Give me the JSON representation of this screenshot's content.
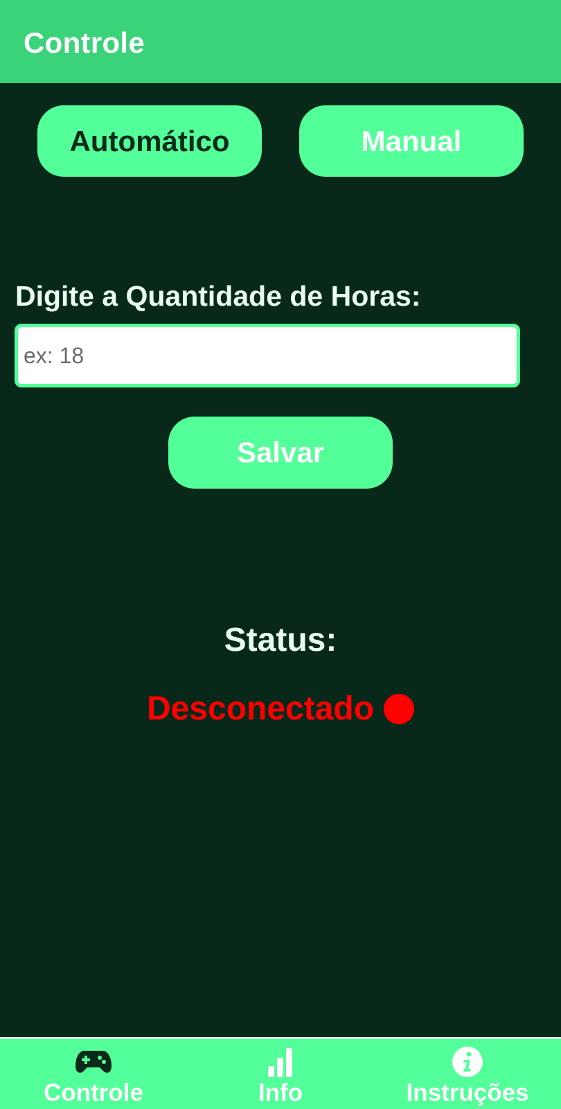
{
  "appbar": {
    "title": "Controle"
  },
  "modes": {
    "automatic_label": "Automático",
    "manual_label": "Manual"
  },
  "hours": {
    "label": "Digite a Quantidade de Horas:",
    "value": "",
    "placeholder": "ex: 18"
  },
  "save": {
    "label": "Salvar"
  },
  "status": {
    "label": "Status:",
    "value": "Desconectado",
    "color": "#ff0000"
  },
  "nav": {
    "items": [
      {
        "label": "Controle",
        "icon": "gamepad-icon",
        "active": true
      },
      {
        "label": "Info",
        "icon": "bar-chart-icon",
        "active": false
      },
      {
        "label": "Instruções",
        "icon": "info-icon",
        "active": false
      }
    ]
  },
  "colors": {
    "appbar": "#3bd37a",
    "background": "#08291a",
    "accent": "#52ff98",
    "status_disconnected": "#ff0000"
  }
}
